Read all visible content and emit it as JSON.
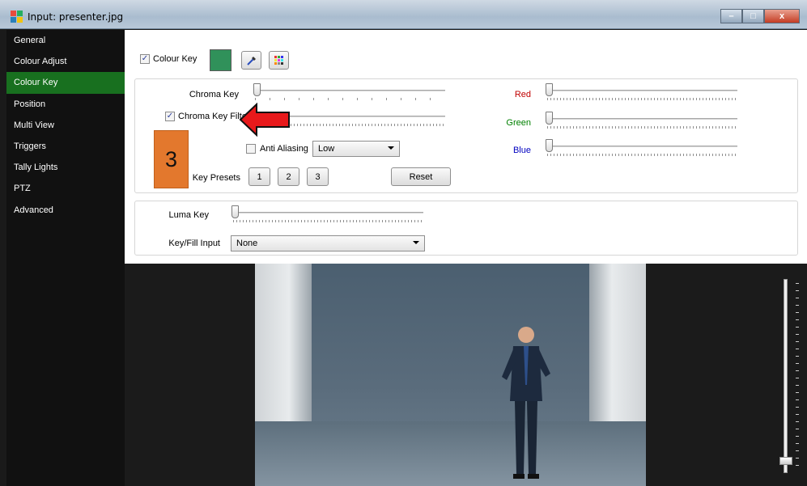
{
  "window": {
    "title": "Input: presenter.jpg",
    "minimize": "–",
    "maximize": "□",
    "close": "x"
  },
  "sidebar": {
    "items": [
      {
        "label": "General"
      },
      {
        "label": "Colour Adjust"
      },
      {
        "label": "Colour Key",
        "active": true
      },
      {
        "label": "Position"
      },
      {
        "label": "Multi View"
      },
      {
        "label": "Triggers"
      },
      {
        "label": "Tally Lights"
      },
      {
        "label": "PTZ"
      },
      {
        "label": "Advanced"
      }
    ]
  },
  "colour_key": {
    "checkbox_label": "Colour Key",
    "checked": true,
    "key_color": "#30915a"
  },
  "chroma": {
    "chroma_key_label": "Chroma Key",
    "chroma_key_filter_label": "Chroma Key Filter",
    "chroma_key_filter_checked": true,
    "anti_aliasing_label": "Anti Aliasing",
    "anti_aliasing_checked": false,
    "anti_aliasing_value": "Low",
    "key_presets_label": "Key Presets",
    "presets": [
      "1",
      "2",
      "3"
    ],
    "reset_label": "Reset",
    "red_label": "Red",
    "green_label": "Green",
    "blue_label": "Blue",
    "red_color": "#c00000",
    "green_color": "#008000",
    "blue_color": "#0000c0"
  },
  "luma": {
    "luma_key_label": "Luma Key",
    "key_fill_input_label": "Key/Fill Input",
    "key_fill_input_value": "None"
  },
  "annotation": {
    "step_number": "3",
    "arrow_color": "#e8191b",
    "badge_color": "#e3782d"
  },
  "icons": {
    "colour_key_check": "check-icon",
    "pipette": "eyedropper-icon",
    "palette": "color-palette-icon"
  }
}
